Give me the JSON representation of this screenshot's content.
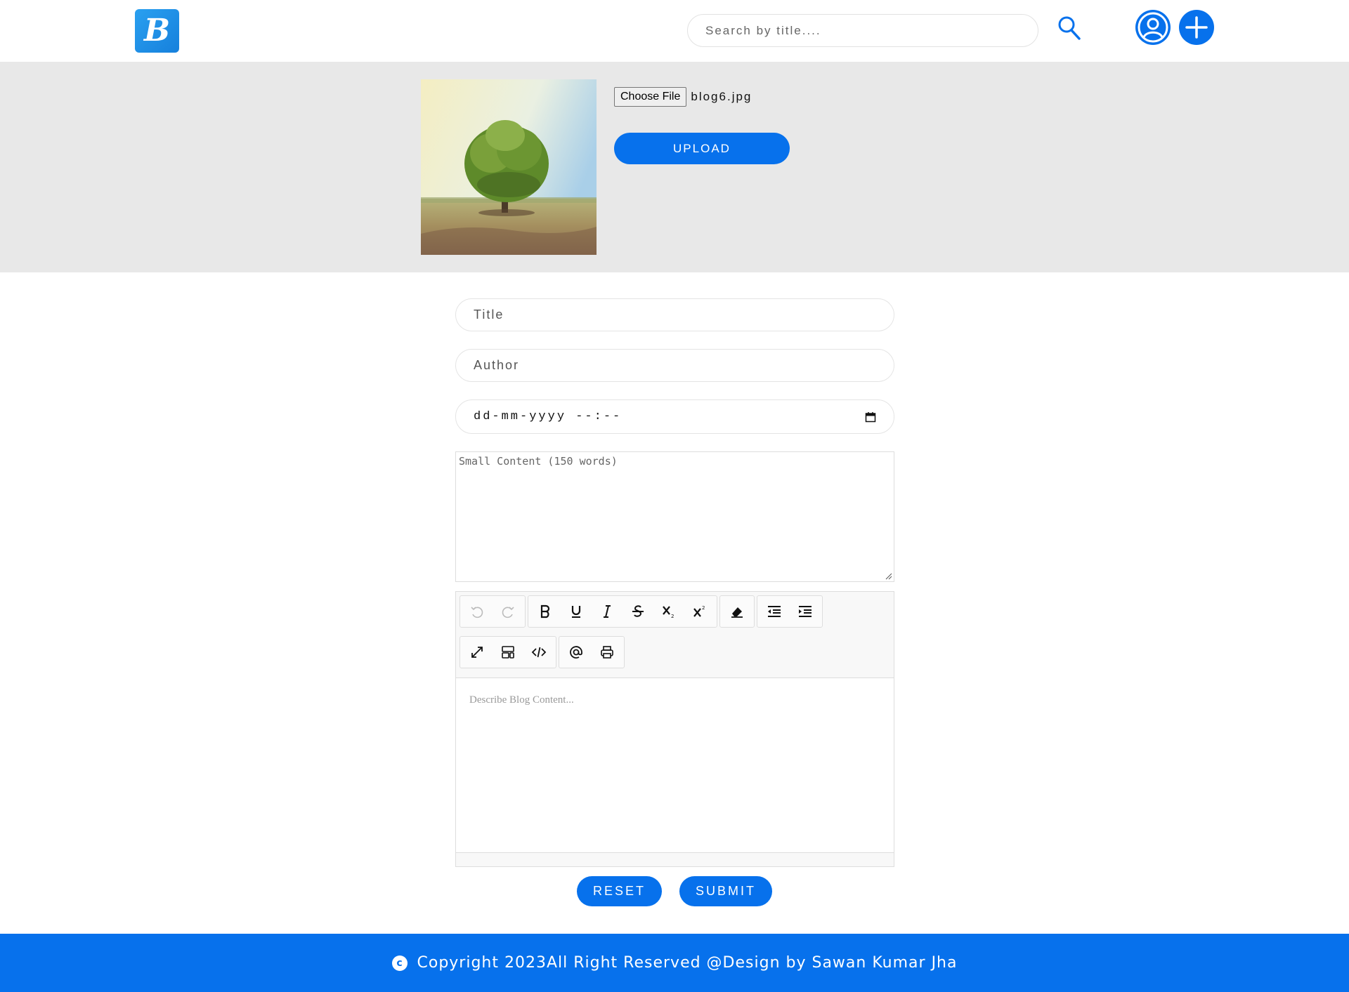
{
  "header": {
    "logo_letter": "B",
    "search_placeholder": "Search by title...."
  },
  "upload": {
    "choose_file_label": "Choose File",
    "file_name": "blog6.jpg",
    "upload_label": "UPLOAD"
  },
  "form": {
    "title_placeholder": "Title",
    "author_placeholder": "Author",
    "date_placeholder": "dd-mm-yyyy --:--",
    "small_content_placeholder": "Small Content (150 words)",
    "editor_placeholder": "Describe Blog Content...",
    "reset_label": "RESET",
    "submit_label": "SUBMIT"
  },
  "toolbar": {
    "row1": [
      [
        "undo-icon",
        "redo-icon"
      ],
      [
        "bold-icon",
        "underline-icon",
        "italic-icon",
        "strikethrough-icon",
        "subscript-icon",
        "superscript-icon"
      ],
      [
        "eraser-icon"
      ],
      [
        "outdent-icon",
        "indent-icon"
      ]
    ],
    "row2": [
      [
        "fullsize-icon",
        "select-all-icon",
        "source-icon"
      ],
      [
        "mention-icon",
        "print-icon"
      ]
    ]
  },
  "footer": {
    "copyright_symbol": "c",
    "text": "Copyright 2023All Right Reserved @Design by Sawan Kumar Jha"
  },
  "colors": {
    "accent": "#0771ec",
    "band": "#e8e8e8"
  }
}
